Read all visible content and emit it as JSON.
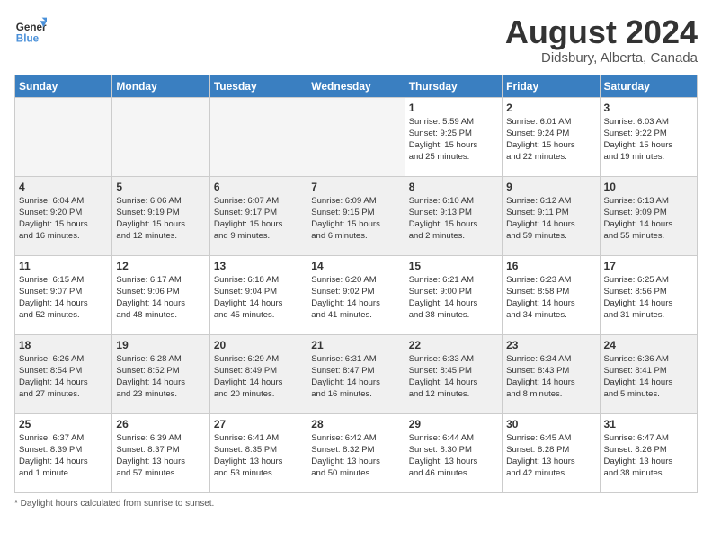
{
  "logo": {
    "line1": "General",
    "line2": "Blue"
  },
  "title": "August 2024",
  "subtitle": "Didsbury, Alberta, Canada",
  "weekdays": [
    "Sunday",
    "Monday",
    "Tuesday",
    "Wednesday",
    "Thursday",
    "Friday",
    "Saturday"
  ],
  "weeks": [
    [
      {
        "day": "",
        "info": ""
      },
      {
        "day": "",
        "info": ""
      },
      {
        "day": "",
        "info": ""
      },
      {
        "day": "",
        "info": ""
      },
      {
        "day": "1",
        "info": "Sunrise: 5:59 AM\nSunset: 9:25 PM\nDaylight: 15 hours\nand 25 minutes."
      },
      {
        "day": "2",
        "info": "Sunrise: 6:01 AM\nSunset: 9:24 PM\nDaylight: 15 hours\nand 22 minutes."
      },
      {
        "day": "3",
        "info": "Sunrise: 6:03 AM\nSunset: 9:22 PM\nDaylight: 15 hours\nand 19 minutes."
      }
    ],
    [
      {
        "day": "4",
        "info": "Sunrise: 6:04 AM\nSunset: 9:20 PM\nDaylight: 15 hours\nand 16 minutes."
      },
      {
        "day": "5",
        "info": "Sunrise: 6:06 AM\nSunset: 9:19 PM\nDaylight: 15 hours\nand 12 minutes."
      },
      {
        "day": "6",
        "info": "Sunrise: 6:07 AM\nSunset: 9:17 PM\nDaylight: 15 hours\nand 9 minutes."
      },
      {
        "day": "7",
        "info": "Sunrise: 6:09 AM\nSunset: 9:15 PM\nDaylight: 15 hours\nand 6 minutes."
      },
      {
        "day": "8",
        "info": "Sunrise: 6:10 AM\nSunset: 9:13 PM\nDaylight: 15 hours\nand 2 minutes."
      },
      {
        "day": "9",
        "info": "Sunrise: 6:12 AM\nSunset: 9:11 PM\nDaylight: 14 hours\nand 59 minutes."
      },
      {
        "day": "10",
        "info": "Sunrise: 6:13 AM\nSunset: 9:09 PM\nDaylight: 14 hours\nand 55 minutes."
      }
    ],
    [
      {
        "day": "11",
        "info": "Sunrise: 6:15 AM\nSunset: 9:07 PM\nDaylight: 14 hours\nand 52 minutes."
      },
      {
        "day": "12",
        "info": "Sunrise: 6:17 AM\nSunset: 9:06 PM\nDaylight: 14 hours\nand 48 minutes."
      },
      {
        "day": "13",
        "info": "Sunrise: 6:18 AM\nSunset: 9:04 PM\nDaylight: 14 hours\nand 45 minutes."
      },
      {
        "day": "14",
        "info": "Sunrise: 6:20 AM\nSunset: 9:02 PM\nDaylight: 14 hours\nand 41 minutes."
      },
      {
        "day": "15",
        "info": "Sunrise: 6:21 AM\nSunset: 9:00 PM\nDaylight: 14 hours\nand 38 minutes."
      },
      {
        "day": "16",
        "info": "Sunrise: 6:23 AM\nSunset: 8:58 PM\nDaylight: 14 hours\nand 34 minutes."
      },
      {
        "day": "17",
        "info": "Sunrise: 6:25 AM\nSunset: 8:56 PM\nDaylight: 14 hours\nand 31 minutes."
      }
    ],
    [
      {
        "day": "18",
        "info": "Sunrise: 6:26 AM\nSunset: 8:54 PM\nDaylight: 14 hours\nand 27 minutes."
      },
      {
        "day": "19",
        "info": "Sunrise: 6:28 AM\nSunset: 8:52 PM\nDaylight: 14 hours\nand 23 minutes."
      },
      {
        "day": "20",
        "info": "Sunrise: 6:29 AM\nSunset: 8:49 PM\nDaylight: 14 hours\nand 20 minutes."
      },
      {
        "day": "21",
        "info": "Sunrise: 6:31 AM\nSunset: 8:47 PM\nDaylight: 14 hours\nand 16 minutes."
      },
      {
        "day": "22",
        "info": "Sunrise: 6:33 AM\nSunset: 8:45 PM\nDaylight: 14 hours\nand 12 minutes."
      },
      {
        "day": "23",
        "info": "Sunrise: 6:34 AM\nSunset: 8:43 PM\nDaylight: 14 hours\nand 8 minutes."
      },
      {
        "day": "24",
        "info": "Sunrise: 6:36 AM\nSunset: 8:41 PM\nDaylight: 14 hours\nand 5 minutes."
      }
    ],
    [
      {
        "day": "25",
        "info": "Sunrise: 6:37 AM\nSunset: 8:39 PM\nDaylight: 14 hours\nand 1 minute."
      },
      {
        "day": "26",
        "info": "Sunrise: 6:39 AM\nSunset: 8:37 PM\nDaylight: 13 hours\nand 57 minutes."
      },
      {
        "day": "27",
        "info": "Sunrise: 6:41 AM\nSunset: 8:35 PM\nDaylight: 13 hours\nand 53 minutes."
      },
      {
        "day": "28",
        "info": "Sunrise: 6:42 AM\nSunset: 8:32 PM\nDaylight: 13 hours\nand 50 minutes."
      },
      {
        "day": "29",
        "info": "Sunrise: 6:44 AM\nSunset: 8:30 PM\nDaylight: 13 hours\nand 46 minutes."
      },
      {
        "day": "30",
        "info": "Sunrise: 6:45 AM\nSunset: 8:28 PM\nDaylight: 13 hours\nand 42 minutes."
      },
      {
        "day": "31",
        "info": "Sunrise: 6:47 AM\nSunset: 8:26 PM\nDaylight: 13 hours\nand 38 minutes."
      }
    ]
  ],
  "footer": "Daylight hours"
}
